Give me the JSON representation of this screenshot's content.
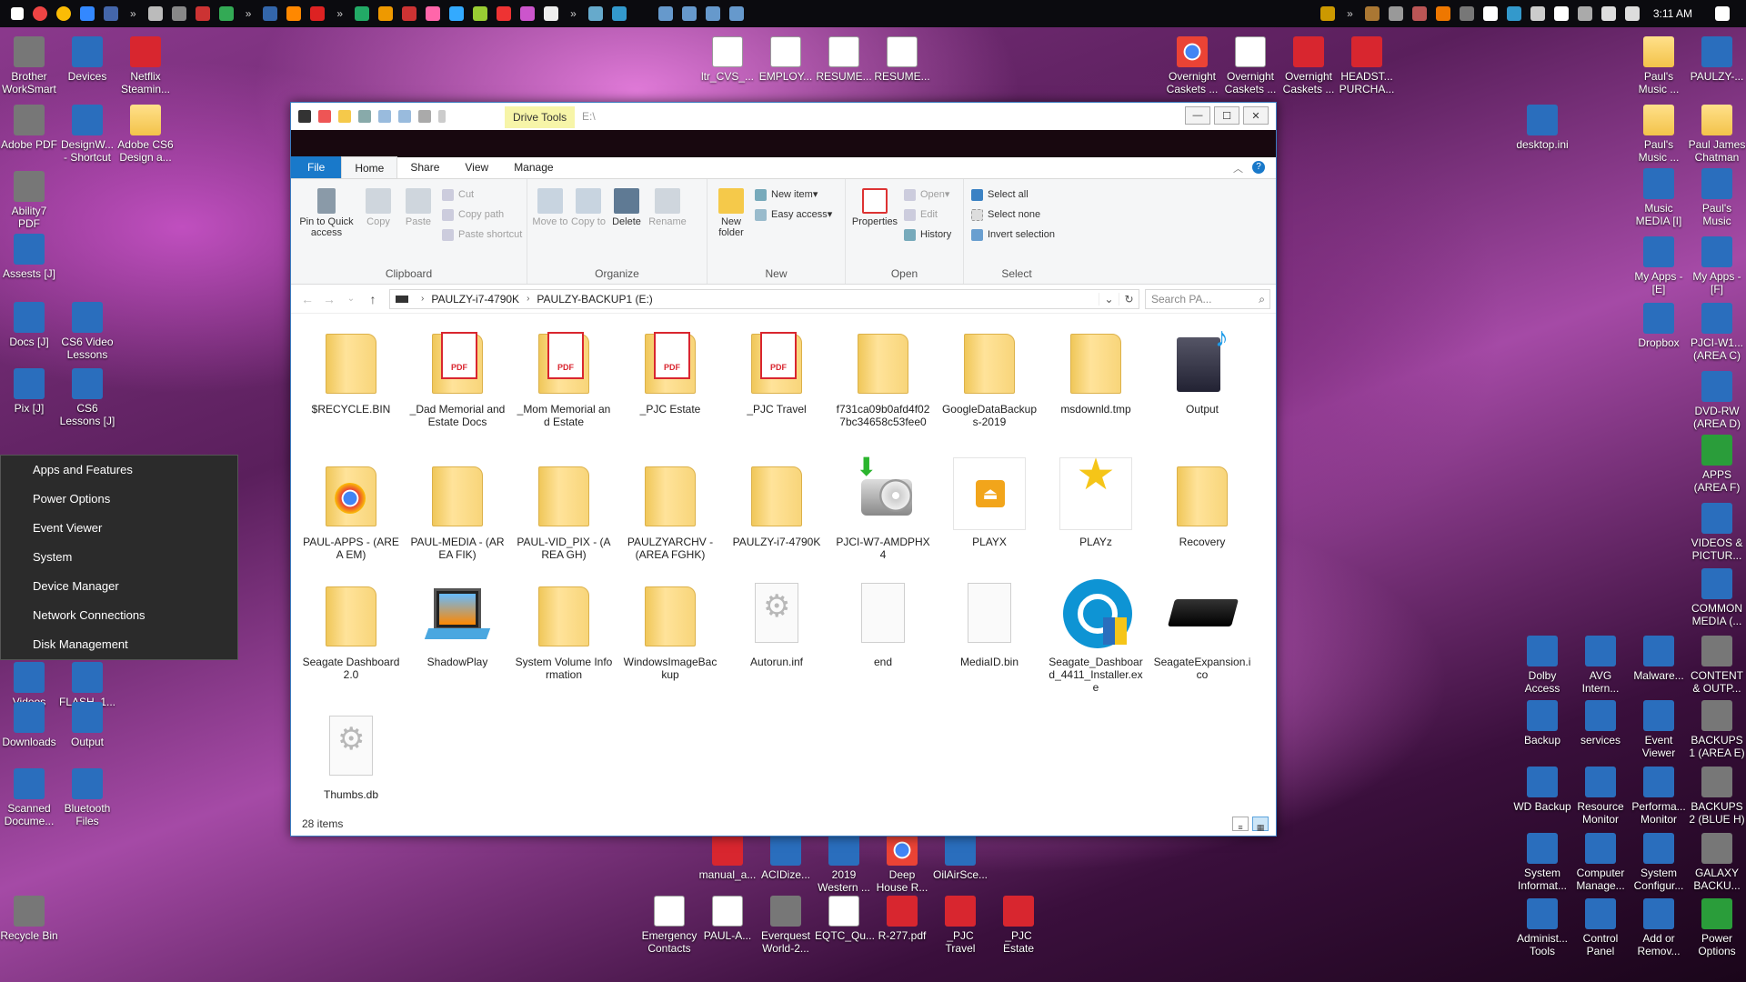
{
  "taskbar": {
    "clock": "3:11 AM",
    "chevrons": [
      "»",
      "»",
      "»",
      "»",
      "»"
    ]
  },
  "desktop_icons": [
    {
      "label": "Brother WorkSmart",
      "icon": "printer-icon"
    },
    {
      "label": "Devices",
      "icon": "devices-icon"
    },
    {
      "label": "Netflix Steamin...",
      "icon": "netflix-icon"
    },
    {
      "label": "Adobe PDF",
      "icon": "printer-icon"
    },
    {
      "label": "DesignW... - Shortcut",
      "icon": "app-icon"
    },
    {
      "label": "Adobe CS6 Design a...",
      "icon": "folder-icon"
    },
    {
      "label": "Ability7 PDF",
      "icon": "printer-icon"
    },
    {
      "label": "Assests [J]",
      "icon": "lightbulb-icon"
    },
    {
      "label": "Docs [J]",
      "icon": "docs-icon"
    },
    {
      "label": "CS6 Video Lessons",
      "icon": "flash-icon"
    },
    {
      "label": "Pix [J]",
      "icon": "pix-icon"
    },
    {
      "label": "CS6 Lessons [J]",
      "icon": "lessons-icon"
    },
    {
      "label": "Videos",
      "icon": "video-icon"
    },
    {
      "label": "FLASH_1...",
      "icon": "flash-icon"
    },
    {
      "label": "Downloads",
      "icon": "downloads-icon"
    },
    {
      "label": "Output",
      "icon": "output-icon"
    },
    {
      "label": "Scanned Docume...",
      "icon": "scanner-icon"
    },
    {
      "label": "Bluetooth Files",
      "icon": "bluetooth-icon"
    },
    {
      "label": "Recycle Bin",
      "icon": "recycle-bin-icon"
    },
    {
      "label": "ltr_CVS_...",
      "icon": "document-icon"
    },
    {
      "label": "EMPLOY...",
      "icon": "document-icon"
    },
    {
      "label": "RESUME...",
      "icon": "document-icon"
    },
    {
      "label": "RESUME...",
      "icon": "document-icon"
    },
    {
      "label": "Overnight Caskets ...",
      "icon": "chrome-icon"
    },
    {
      "label": "Overnight Caskets ...",
      "icon": "word-icon"
    },
    {
      "label": "Overnight Caskets ...",
      "icon": "pdf-icon"
    },
    {
      "label": "HEADST... PURCHA...",
      "icon": "pdf-icon"
    },
    {
      "label": "desktop.ini",
      "icon": "settings-file-icon"
    },
    {
      "label": "Paul's Music ...",
      "icon": "music-folder-icon"
    },
    {
      "label": "PAULZY-...",
      "icon": "computer-icon"
    },
    {
      "label": "Paul's Music ...",
      "icon": "music-folder-icon"
    },
    {
      "label": "Paul James Chatman",
      "icon": "folder-icon"
    },
    {
      "label": "Music MEDIA [I]",
      "icon": "media-icon"
    },
    {
      "label": "Paul's Music",
      "icon": "music-icon"
    },
    {
      "label": "My Apps - [E]",
      "icon": "cloud-icon"
    },
    {
      "label": "My Apps - [F]",
      "icon": "info-icon"
    },
    {
      "label": "Dropbox",
      "icon": "dropbox-icon"
    },
    {
      "label": "PJCI-W1... (AREA C)",
      "icon": "computer-icon"
    },
    {
      "label": "DVD-RW (AREA D)",
      "icon": "dvd-icon"
    },
    {
      "label": "APPS (AREA F)",
      "icon": "apps-icon"
    },
    {
      "label": "VIDEOS & PICTUR...",
      "icon": "video-icon"
    },
    {
      "label": "COMMON MEDIA (...",
      "icon": "media-icon"
    },
    {
      "label": "Dolby Access",
      "icon": "dolby-icon"
    },
    {
      "label": "AVG Intern...",
      "icon": "avg-icon"
    },
    {
      "label": "Malware...",
      "icon": "malware-icon"
    },
    {
      "label": "CONTENT & OUTP...",
      "icon": "drive-icon"
    },
    {
      "label": "Backup",
      "icon": "backup-icon"
    },
    {
      "label": "services",
      "icon": "services-icon"
    },
    {
      "label": "Event Viewer",
      "icon": "event-viewer-icon"
    },
    {
      "label": "BACKUPS 1 (AREA E)",
      "icon": "drive-icon"
    },
    {
      "label": "WD Backup",
      "icon": "wd-icon"
    },
    {
      "label": "Resource Monitor",
      "icon": "monitor-icon"
    },
    {
      "label": "Performa... Monitor",
      "icon": "perf-icon"
    },
    {
      "label": "BACKUPS 2 (BLUE H)",
      "icon": "drive-icon"
    },
    {
      "label": "System Informat...",
      "icon": "sysinfo-icon"
    },
    {
      "label": "Computer Manage...",
      "icon": "compmgmt-icon"
    },
    {
      "label": "System Configur...",
      "icon": "sysconfig-icon"
    },
    {
      "label": "GALAXY BACKU...",
      "icon": "drive-icon"
    },
    {
      "label": "Administ... Tools",
      "icon": "admin-tools-icon"
    },
    {
      "label": "Control Panel",
      "icon": "control-panel-icon"
    },
    {
      "label": "Add or Remov...",
      "icon": "add-remove-icon"
    },
    {
      "label": "Power Options",
      "icon": "power-icon"
    },
    {
      "label": "manual_a...",
      "icon": "pdf-icon"
    },
    {
      "label": "ACIDize...",
      "icon": "app-icon"
    },
    {
      "label": "2019 Western ...",
      "icon": "app-icon"
    },
    {
      "label": "Deep House R...",
      "icon": "chrome-icon"
    },
    {
      "label": "OilAirSce...",
      "icon": "app-icon"
    },
    {
      "label": "Emergency Contacts",
      "icon": "document-icon"
    },
    {
      "label": "PAUL-A...",
      "icon": "document-icon"
    },
    {
      "label": "Everquest World-2...",
      "icon": "image-icon"
    },
    {
      "label": "EQTC_Qu...",
      "icon": "document-icon"
    },
    {
      "label": "R-277.pdf",
      "icon": "pdf-icon"
    },
    {
      "label": "_PJC Travel",
      "icon": "pdf-icon"
    },
    {
      "label": "_PJC Estate",
      "icon": "pdf-icon"
    }
  ],
  "context_menu": {
    "items": [
      "Apps and Features",
      "Power Options",
      "Event Viewer",
      "System",
      "Device Manager",
      "Network Connections",
      "Disk Management"
    ]
  },
  "explorer": {
    "contextual_tab": "Drive Tools",
    "title": "E:\\",
    "window_buttons": {
      "minimize": "—",
      "maximize": "☐",
      "close": "✕"
    },
    "tabs": [
      "File",
      "Home",
      "Share",
      "View",
      "Manage"
    ],
    "active_tab": "Home",
    "ribbon": {
      "clipboard": {
        "label": "Clipboard",
        "pin": "Pin to Quick access",
        "copy": "Copy",
        "paste": "Paste",
        "cut": "Cut",
        "copy_path": "Copy path",
        "paste_shortcut": "Paste shortcut"
      },
      "organize": {
        "label": "Organize",
        "move_to": "Move to",
        "copy_to": "Copy to",
        "delete": "Delete",
        "rename": "Rename"
      },
      "new": {
        "label": "New",
        "new_folder": "New folder",
        "new_item": "New item",
        "easy_access": "Easy access"
      },
      "open": {
        "label": "Open",
        "properties": "Properties",
        "open": "Open",
        "edit": "Edit",
        "history": "History"
      },
      "select": {
        "label": "Select",
        "select_all": "Select all",
        "select_none": "Select none",
        "invert": "Invert selection"
      }
    },
    "address": {
      "crumbs": [
        "PAULZY-i7-4790K",
        "PAULZY-BACKUP1 (E:)"
      ],
      "search_placeholder": "Search PA..."
    },
    "files": [
      {
        "name": "$RECYCLE.BIN",
        "type": "folder"
      },
      {
        "name": "_Dad Memorial and Estate Docs",
        "type": "pdf-folder"
      },
      {
        "name": "_Mom Memorial and Estate",
        "type": "pdf-folder"
      },
      {
        "name": "_PJC Estate",
        "type": "pdf-folder"
      },
      {
        "name": "_PJC Travel",
        "type": "pdf-folder"
      },
      {
        "name": "f731ca09b0afd4f027bc34658c53fee0",
        "type": "folder"
      },
      {
        "name": "GoogleDataBackups-2019",
        "type": "folder"
      },
      {
        "name": "msdownld.tmp",
        "type": "folder"
      },
      {
        "name": "Output",
        "type": "app"
      },
      {
        "name": "PAUL-APPS - (AREA EM)",
        "type": "chrome-folder"
      },
      {
        "name": "PAUL-MEDIA - (AREA FIK)",
        "type": "folder"
      },
      {
        "name": "PAUL-VID_PIX - (AREA GH)",
        "type": "folder"
      },
      {
        "name": "PAULZYARCHV - (AREA FGHK)",
        "type": "folder"
      },
      {
        "name": "PAULZY-i7-4790K",
        "type": "folder"
      },
      {
        "name": "PJCI-W7-AMDPHX4",
        "type": "disc"
      },
      {
        "name": "PLAYX",
        "type": "playx"
      },
      {
        "name": "PLAYz",
        "type": "star"
      },
      {
        "name": "Recovery",
        "type": "folder"
      },
      {
        "name": "Seagate Dashboard 2.0",
        "type": "folder"
      },
      {
        "name": "ShadowPlay",
        "type": "film"
      },
      {
        "name": "System Volume Information",
        "type": "folder"
      },
      {
        "name": "WindowsImageBackup",
        "type": "folder"
      },
      {
        "name": "Autorun.inf",
        "type": "settings-file"
      },
      {
        "name": "end",
        "type": "file"
      },
      {
        "name": "MediaID.bin",
        "type": "file"
      },
      {
        "name": "Seagate_Dashboard_4411_Installer.exe",
        "type": "seagate"
      },
      {
        "name": "SeagateExpansion.ico",
        "type": "drive"
      },
      {
        "name": "Thumbs.db",
        "type": "settings-file"
      }
    ],
    "status": "28 items"
  }
}
